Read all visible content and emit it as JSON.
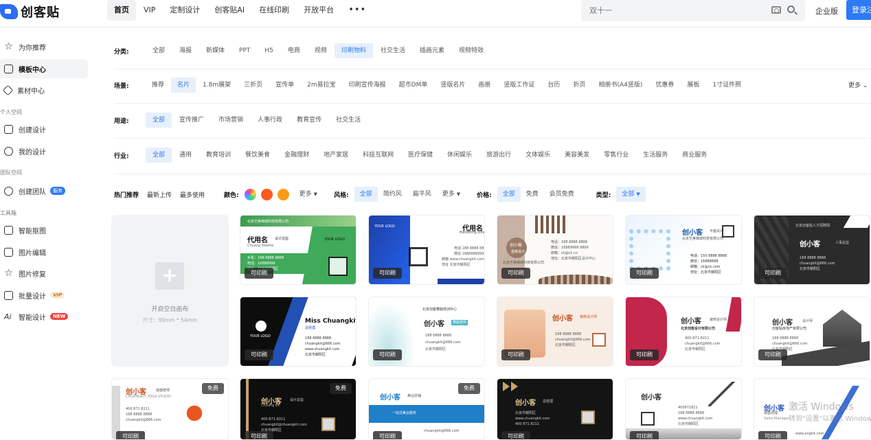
{
  "app": {
    "logo_text": "创客贴",
    "brand_color": "#2c6df2"
  },
  "topnav": {
    "items": [
      "首页",
      "VIP",
      "定制设计",
      "创客贴AI",
      "在线印刷",
      "开放平台"
    ],
    "more": "•••",
    "active": "首页"
  },
  "search": {
    "placeholder": "双十一"
  },
  "header": {
    "enterprise": "企业版",
    "login": "登录注"
  },
  "sidebar": {
    "items": [
      {
        "label": "为你推荐",
        "icon": "star-icon"
      },
      {
        "label": "模板中心",
        "icon": "template-icon",
        "active": true
      },
      {
        "label": "素材中心",
        "icon": "cube-icon"
      }
    ],
    "section_personal": "个人空间",
    "personal": [
      {
        "label": "创建设计",
        "icon": "create-design-icon"
      },
      {
        "label": "我的设计",
        "icon": "user-icon"
      }
    ],
    "section_team": "团队空间",
    "team": [
      {
        "label": "创建团队",
        "icon": "team-icon",
        "badge": "服务"
      }
    ],
    "section_tools": "工具箱",
    "tools": [
      {
        "label": "智能抠图",
        "icon": "cutout-icon"
      },
      {
        "label": "图片编辑",
        "icon": "image-edit-icon"
      },
      {
        "label": "图片修复",
        "icon": "repair-icon"
      },
      {
        "label": "批量设计",
        "icon": "batch-icon",
        "badge": "VIP"
      },
      {
        "label": "智能设计",
        "icon": "ai-icon",
        "badge": "NEW"
      }
    ]
  },
  "filters": {
    "category": {
      "label": "分类:",
      "options": [
        "全部",
        "海报",
        "新媒体",
        "PPT",
        "H5",
        "电商",
        "视频",
        "印刷物料",
        "社交生活",
        "插画元素",
        "视频特效"
      ],
      "active": 7
    },
    "scene": {
      "label": "场景:",
      "options": [
        "推荐",
        "名片",
        "1.8m展架",
        "三折页",
        "宣传单",
        "2m易拉宝",
        "印刷宣传海报",
        "超市DM单",
        "竖版名片",
        "画册",
        "竖版工作证",
        "台历",
        "折页",
        "相册书(A4竖版)",
        "优惠券",
        "展板",
        "1寸证件照"
      ],
      "active": 1,
      "more": "更多"
    },
    "usage": {
      "label": "用途:",
      "options": [
        "全部",
        "宣传推广",
        "市场营销",
        "人事行政",
        "教育宣传",
        "社交生活"
      ],
      "active": 0
    },
    "industry": {
      "label": "行业:",
      "options": [
        "全部",
        "通用",
        "教育培训",
        "餐饮美食",
        "金融理财",
        "地产家居",
        "科技互联网",
        "医疗保健",
        "休闲娱乐",
        "旅游出行",
        "文体娱乐",
        "美容美发",
        "零售行业",
        "生活服务",
        "商业服务"
      ],
      "active": 0
    }
  },
  "sort": {
    "tabs": [
      "热门推荐",
      "最新上传",
      "最多使用"
    ],
    "active": 0
  },
  "color_filter": {
    "label": "颜色:",
    "colors": [
      "#ff6b3d",
      "#ff9d19"
    ],
    "more": "更多"
  },
  "style_filter": {
    "label": "风格:",
    "options": [
      "全部",
      "简约风",
      "扁平风"
    ],
    "more": "更多"
  },
  "price_filter": {
    "label": "价格:",
    "options": [
      "全部",
      "免费",
      "会员免费"
    ]
  },
  "type_filter": {
    "label": "类型:",
    "value": "全部"
  },
  "blank_canvas": {
    "title": "开启空白画布",
    "size": "尺寸：90mm * 54mm"
  },
  "print_tag": "可印刷",
  "free_tag": "免费",
  "cards": [
    {
      "name": "代用名",
      "sub": "设计总监",
      "company": "北京艺美锦城科技有限公司",
      "lines": [
        "Chuang Kewike",
        "手机：188 8888 8888",
        "电话：16888999",
        "地址：北京市朝阳区",
        "YOUR LOGO"
      ]
    },
    {
      "name": "代用名",
      "sub": "Marketing Director",
      "lines": [
        "YOUR LOGO",
        "电话 188 8888 8888",
        "微信 16888889999",
        "邮箱 www.chuangkit.com",
        "地址 北京市朝阳区"
      ]
    },
    {
      "name": "创小客",
      "sub": "首席设计",
      "lines": [
        "电话：188 8888 8888",
        "微信：16889999 8899",
        "邮箱：ck@ck.cn",
        "地址：北京市朝阳区设计中心",
        "北京艺美锦城科技有限公司"
      ]
    },
    {
      "name": "创小客",
      "sub": "平面设计师",
      "lines": [
        "北京艺美锦城科技有限公司",
        "电话：150 8888 8888",
        "微信：16888888",
        "邮箱：ck@ck.com",
        "地址：北京市朝阳区"
      ]
    },
    {
      "name": "创小客",
      "sub": "人事总监",
      "lines": [
        "北京创客贴人才招聘网",
        "188 8888 8888",
        "chuangkit@666.com",
        "北京市朝阳区"
      ]
    },
    {
      "name": "Miss Chuangkit",
      "sub": "总经理",
      "lines": [
        "YOUR LOGO",
        "188 8888 8888",
        "chuangkit@666.com",
        "www.chuangkit.com",
        "北京市朝阳区"
      ]
    },
    {
      "name": "创小客",
      "sub": "舞蹈老师",
      "lines": [
        "北京创客舞蹈培训中心",
        "188 8888 8888",
        "chuangkit@666.com",
        "北京市朝阳区"
      ]
    },
    {
      "name": "创小客",
      "sub": "装修设计师",
      "lines": [
        "188 8888 8888",
        "chuangkit@666.com",
        "北京市朝阳区"
      ]
    },
    {
      "name": "创小客",
      "sub": "装修设计师",
      "lines": [
        "北京创客设计有限公司",
        "400-871-8211",
        "chuangkit@666.com",
        "北京市朝阳区"
      ]
    },
    {
      "name": "创小客",
      "sub": "设计师",
      "lines": [
        "创客贴房地产有限公司",
        "188 8888 8888",
        "chuangkit@666.com",
        "北京市朝阳区"
      ]
    },
    {
      "name": "创小客",
      "sub": "瑜伽老师",
      "lines": [
        "CHUANGKIT YOGA STUDIO",
        "400 871 8211",
        "188 8888 8888",
        "chuangkit@666.com"
      ]
    },
    {
      "name": "创小客",
      "sub": "设计总监",
      "lines": [
        "Chuang kit",
        "400-871-8211",
        "chuangkit@chuangkit.com",
        "北京市朝阳区"
      ]
    },
    {
      "name": "创小客",
      "sub": "美业店铺",
      "lines": [
        "一站式美业服务",
        "chuangkit@666.com"
      ]
    },
    {
      "name": "创小客",
      "sub": "总经理",
      "lines": [
        "北京市朝阳区",
        "www.chuangkit.com",
        "400 871 8211"
      ]
    },
    {
      "name": "创小客",
      "sub": "",
      "lines": [
        "400871821",
        "188 8888 8888",
        "www.chuangkit.com",
        "北京市朝阳区"
      ]
    },
    {
      "name": "创小客",
      "sub": "销售经理",
      "lines": [
        "Sales Manager",
        "www.angkit.com"
      ]
    }
  ],
  "watermark": {
    "line1": "激活 Windows",
    "line2": "转到\"设置\"以激活 Windows。"
  }
}
